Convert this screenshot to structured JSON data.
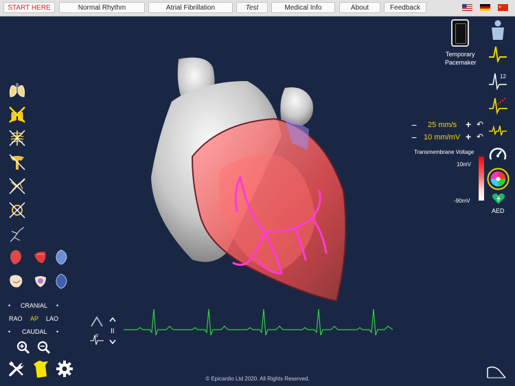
{
  "topbar": {
    "buttons": [
      {
        "label": "START HERE"
      },
      {
        "label": "Normal Rhythm"
      },
      {
        "label": "Atrial Fibrillation"
      },
      {
        "label": "Test"
      },
      {
        "label": "Medical Info"
      },
      {
        "label": "About"
      },
      {
        "label": "Feedback"
      }
    ],
    "flags": [
      "us-flag-icon",
      "germany-flag-icon",
      "china-flag-icon"
    ]
  },
  "pacemaker": {
    "line1": "Temporary",
    "line2": "Pacemaker"
  },
  "ecg_controls": {
    "speed": {
      "value": "25 mm/s",
      "minus": "−",
      "plus": "+",
      "reset": "↶"
    },
    "gain": {
      "value": "10 mm/mV",
      "minus": "−",
      "plus": "+",
      "reset": "↶"
    }
  },
  "voltage": {
    "title": "Transmembrane Voltage",
    "max": "10mV",
    "min": "-90mV"
  },
  "aed": {
    "label": "AED"
  },
  "right_lead_label": "12",
  "view": {
    "cranial": "CRANIAL",
    "caudal": "CAUDAL",
    "rao": "RAO",
    "ap": "AP",
    "lao": "LAO",
    "bullet": "•"
  },
  "playback": {
    "pause": "II",
    "lead": "II"
  },
  "footer": {
    "copyright": "© Epicardio Ltd 2020. All Rights Reserved."
  },
  "colors": {
    "accent_yellow": "#f0d800",
    "start_red": "#e0251b",
    "ecg_green": "#2fd23f",
    "background": "#1a2744"
  }
}
